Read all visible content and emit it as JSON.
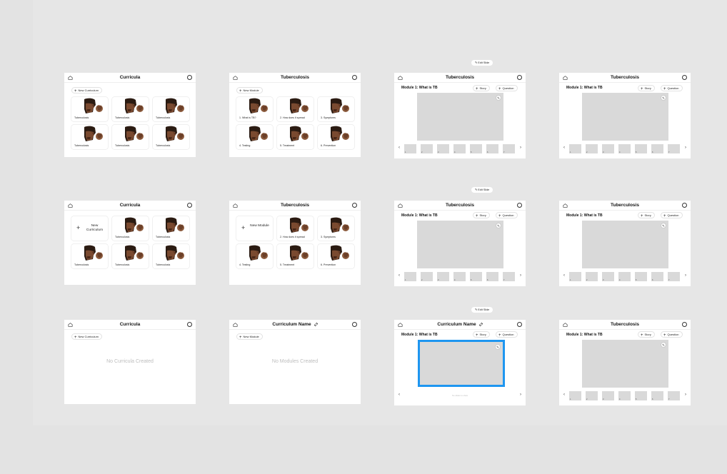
{
  "canvas": "design-board",
  "icons": {
    "home": "home-icon",
    "user": "user-icon",
    "plus": "plus-icon",
    "pencil": "pencil-icon",
    "prev": "chevron-left-icon",
    "next": "chevron-right-icon"
  },
  "colors": {
    "selection": "#1e96f0",
    "placeholder": "#d9d9d9",
    "frame": "#ffffff"
  },
  "common": {
    "plus": "+",
    "prev": "‹",
    "next": "›",
    "pencil": "✎",
    "story": "Story",
    "question": "Question",
    "module_title": "Module 1: What is TB",
    "edit_slide": "Edit Slide",
    "tuberculosis": "Tuberculosis",
    "curricula": "Curricula",
    "new_curriculum": "New Curriculum",
    "new_curriculum_card": "New Curriculum",
    "new_module": "New Module",
    "new_module_card": "New Module",
    "no_curricula": "No Curricula Created",
    "no_modules": "No Modules Created",
    "curriculum_name": "Curriculum Name",
    "no_slides": "No slides to show"
  },
  "modules": [
    "1. What is TB?",
    "2. How does it spread",
    "3. Symptoms",
    "4. Testing",
    "5. Treatment",
    "6. Prevention"
  ],
  "thumb_numbers": [
    "1",
    "2",
    "3",
    "4",
    "5",
    "6",
    "7"
  ]
}
